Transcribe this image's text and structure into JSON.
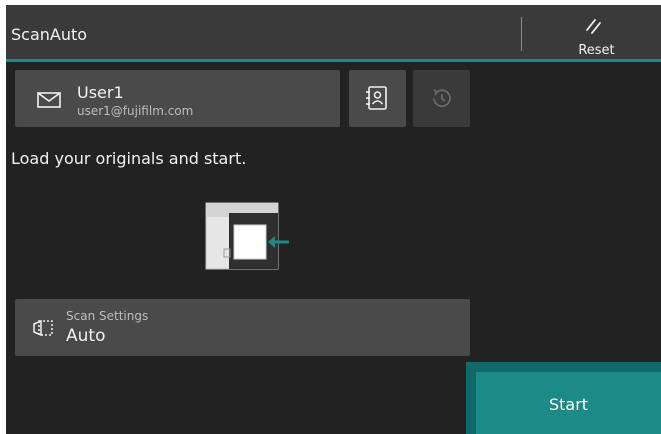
{
  "header": {
    "title": "ScanAuto",
    "reset_label": "Reset"
  },
  "recipient": {
    "name": "User1",
    "email": "user1@fujifilm.com"
  },
  "main": {
    "instruction": "Load your originals and start."
  },
  "scan_settings": {
    "label": "Scan Settings",
    "value": "Auto"
  },
  "actions": {
    "start_label": "Start"
  },
  "icons": {
    "reset": "reset-icon",
    "mail": "mail-icon",
    "address_book": "address-book-icon",
    "history": "history-icon",
    "scanner": "scanner-illustration",
    "scan_settings": "scan-settings-icon"
  },
  "colors": {
    "accent": "#1c8a87",
    "background": "#222222",
    "panel": "#4a4a4a"
  }
}
